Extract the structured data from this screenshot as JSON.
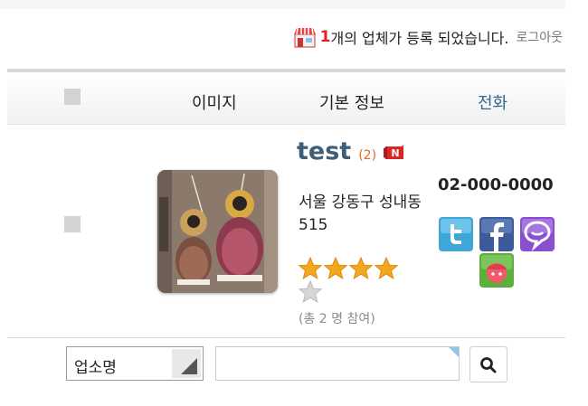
{
  "notice": {
    "count": "1",
    "message": "개의 업체가 등록 되었습니다.",
    "logout": "로그아웃"
  },
  "table_header": {
    "image": "이미지",
    "info": "기본 정보",
    "phone": "전화"
  },
  "listing": {
    "name": "test",
    "review_count": "(2)",
    "new_badge": "N",
    "address": "서울 강동구 성내동 515",
    "rating": 4,
    "rating_max": 5,
    "participants": "(총 2 명 참여)",
    "phone": "02-000-0000",
    "share_icons": [
      "twitter-icon",
      "facebook-icon",
      "chat-bubble-icon",
      "me2day-icon"
    ]
  },
  "search": {
    "field_selected": "업소명",
    "query": ""
  },
  "colors": {
    "count": "#e02424",
    "name": "#3f5e78",
    "phone_header": "#2f6a8e",
    "star": "#f4a71d"
  }
}
